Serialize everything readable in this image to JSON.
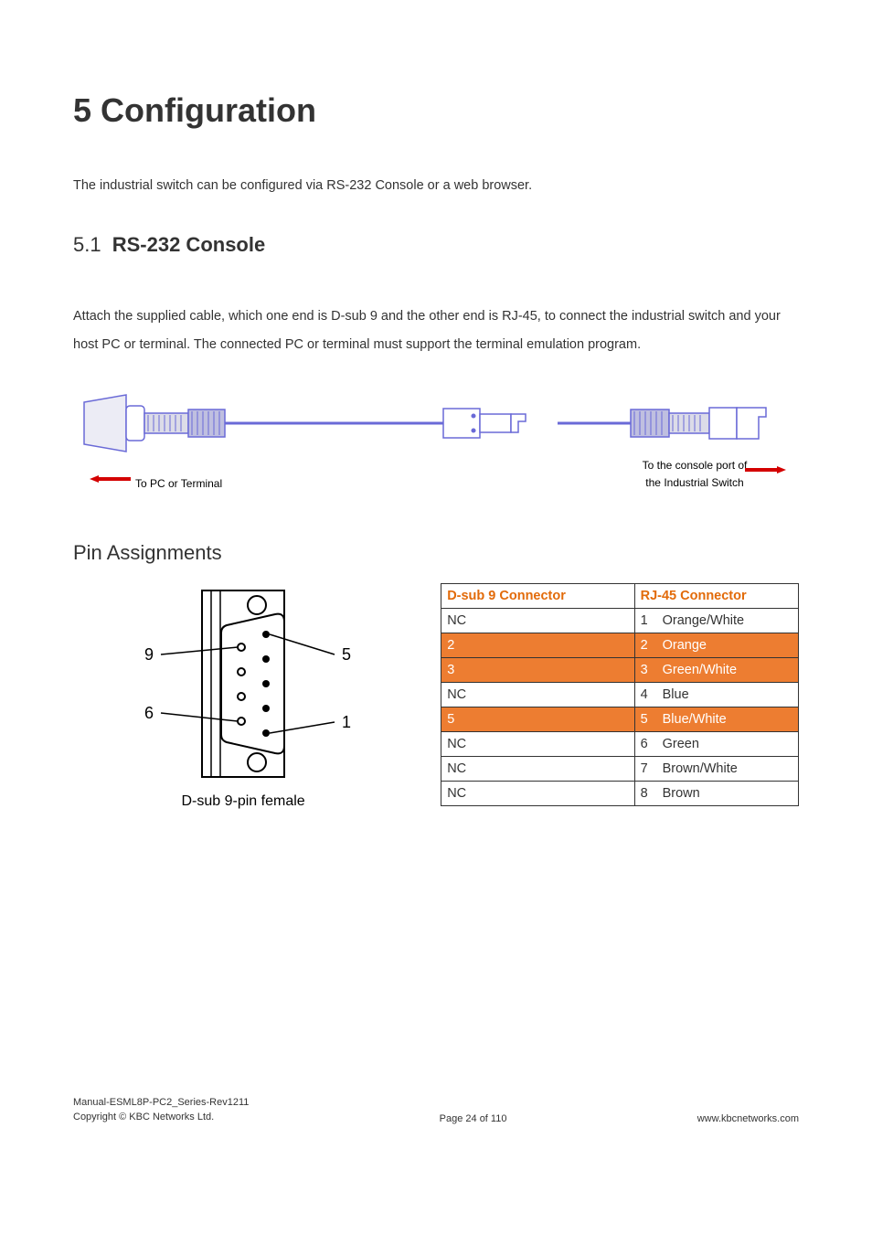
{
  "chapter": {
    "number": "5",
    "title": "Configuration"
  },
  "intro": "The industrial switch can be configured via RS-232 Console or a web browser.",
  "section": {
    "number": "5.1",
    "title": "RS-232 Console"
  },
  "section_body": "Attach the supplied cable, which one end is D-sub 9 and the other end is RJ-45, to connect the industrial switch and your host PC or terminal. The connected PC or terminal must support the terminal emulation program.",
  "diagram": {
    "left_label": "To PC or Terminal",
    "right_label_line1": "To the console port of",
    "right_label_line2": "the Industrial Switch"
  },
  "pin_heading": "Pin Assignments",
  "dsub": {
    "caption": "D-sub 9-pin female",
    "labels": {
      "tl": "9",
      "tr": "5",
      "bl": "6",
      "br": "1"
    }
  },
  "table": {
    "headers": {
      "left": "D-sub 9 Connector",
      "right": "RJ-45 Connector"
    },
    "rows": [
      {
        "left": "NC",
        "n": "1",
        "color": "Orange/White",
        "hl": false
      },
      {
        "left": "2",
        "n": "2",
        "color": "Orange",
        "hl": true
      },
      {
        "left": "3",
        "n": "3",
        "color": "Green/White",
        "hl": true
      },
      {
        "left": "NC",
        "n": "4",
        "color": "Blue",
        "hl": false
      },
      {
        "left": "5",
        "n": "5",
        "color": "Blue/White",
        "hl": true
      },
      {
        "left": "NC",
        "n": "6",
        "color": "Green",
        "hl": false
      },
      {
        "left": "NC",
        "n": "7",
        "color": "Brown/White",
        "hl": false
      },
      {
        "left": "NC",
        "n": "8",
        "color": "Brown",
        "hl": false
      }
    ]
  },
  "footer": {
    "doc_id": "Manual-ESML8P-PC2_Series-Rev1211",
    "copyright": "Copyright © KBC Networks Ltd.",
    "page": "Page 24 of 110",
    "url": "www.kbcnetworks.com"
  }
}
